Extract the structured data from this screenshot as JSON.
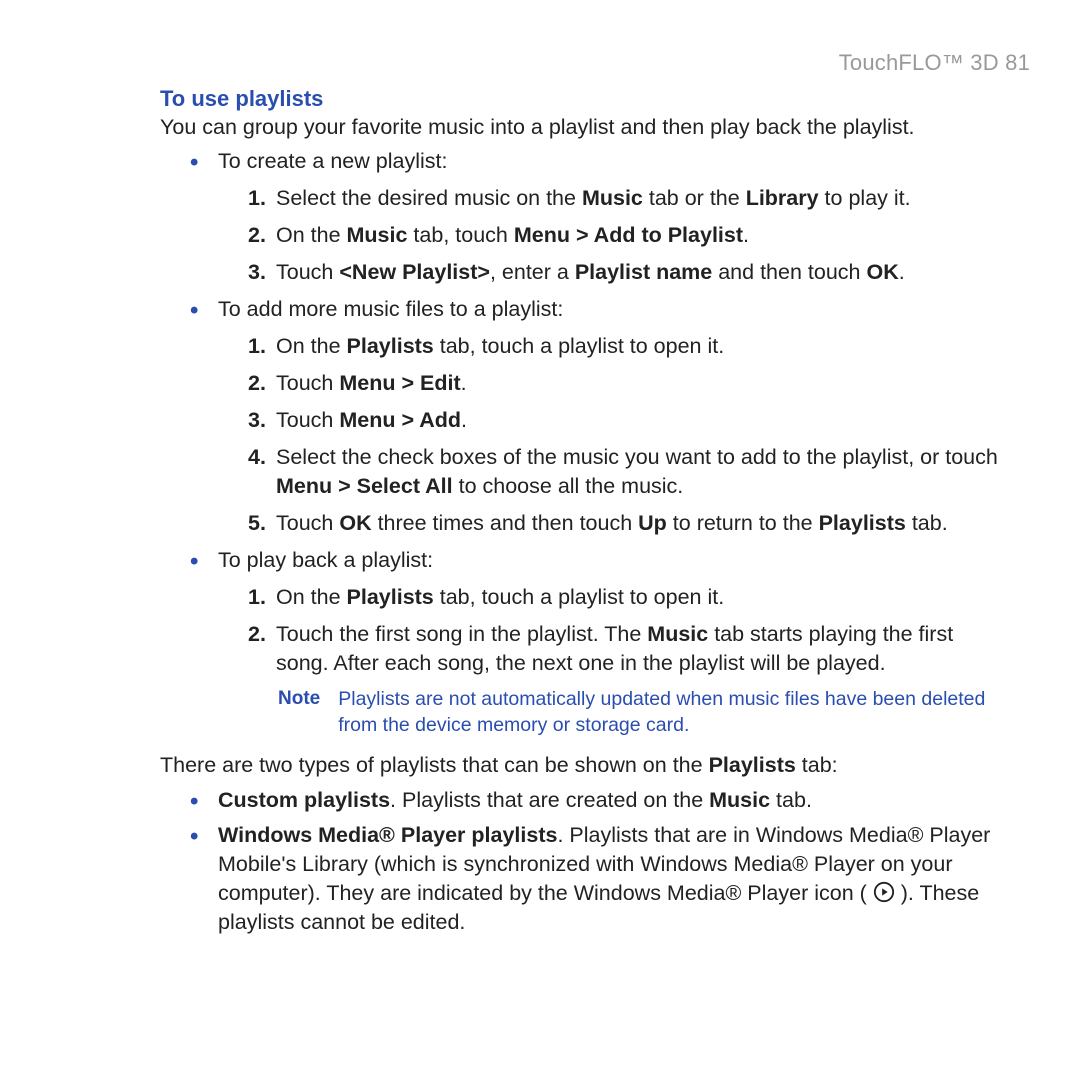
{
  "header": {
    "title": "TouchFLO™ 3D  81"
  },
  "section": {
    "title": "To use playlists",
    "intro": "You can group your favorite music into a playlist and then play back the playlist."
  },
  "groups": [
    {
      "lead": "To create a new playlist:",
      "steps": [
        {
          "parts": [
            {
              "t": "Select the desired music on the "
            },
            {
              "t": "Music",
              "b": true
            },
            {
              "t": " tab or the "
            },
            {
              "t": "Library",
              "b": true
            },
            {
              "t": " to play it."
            }
          ]
        },
        {
          "parts": [
            {
              "t": "On the "
            },
            {
              "t": "Music",
              "b": true
            },
            {
              "t": " tab, touch "
            },
            {
              "t": "Menu > Add to Playlist",
              "b": true
            },
            {
              "t": "."
            }
          ]
        },
        {
          "parts": [
            {
              "t": "Touch "
            },
            {
              "t": "<New Playlist>",
              "b": true
            },
            {
              "t": ", enter a "
            },
            {
              "t": "Playlist name",
              "b": true
            },
            {
              "t": " and then touch "
            },
            {
              "t": "OK",
              "b": true
            },
            {
              "t": "."
            }
          ]
        }
      ]
    },
    {
      "lead": "To add more music files to a playlist:",
      "steps": [
        {
          "parts": [
            {
              "t": "On the "
            },
            {
              "t": "Playlists",
              "b": true
            },
            {
              "t": " tab, touch a playlist to open it."
            }
          ]
        },
        {
          "parts": [
            {
              "t": "Touch "
            },
            {
              "t": "Menu > Edit",
              "b": true
            },
            {
              "t": "."
            }
          ]
        },
        {
          "parts": [
            {
              "t": "Touch "
            },
            {
              "t": "Menu > Add",
              "b": true
            },
            {
              "t": "."
            }
          ]
        },
        {
          "parts": [
            {
              "t": "Select the check boxes of the music you want to add to the playlist, or touch "
            },
            {
              "t": "Menu > Select All",
              "b": true
            },
            {
              "t": " to choose all the music."
            }
          ]
        },
        {
          "parts": [
            {
              "t": "Touch "
            },
            {
              "t": "OK",
              "b": true
            },
            {
              "t": " three times and then touch "
            },
            {
              "t": "Up",
              "b": true
            },
            {
              "t": " to return to the "
            },
            {
              "t": "Playlists",
              "b": true
            },
            {
              "t": " tab."
            }
          ]
        }
      ]
    },
    {
      "lead": "To play back a playlist:",
      "steps": [
        {
          "parts": [
            {
              "t": "On the "
            },
            {
              "t": "Playlists",
              "b": true
            },
            {
              "t": " tab, touch a playlist to open it."
            }
          ]
        },
        {
          "parts": [
            {
              "t": "Touch the first song in the playlist. The "
            },
            {
              "t": "Music",
              "b": true
            },
            {
              "t": " tab starts playing the first song. After each song, the next one in the playlist will be played."
            }
          ]
        }
      ],
      "note": {
        "label": "Note",
        "text": "Playlists are not automatically updated when music files have been deleted from the device memory or storage card."
      }
    }
  ],
  "types_intro": {
    "parts": [
      {
        "t": "There are two types of playlists that can be shown on the "
      },
      {
        "t": "Playlists",
        "b": true
      },
      {
        "t": " tab:"
      }
    ]
  },
  "types": [
    {
      "parts": [
        {
          "t": "Custom playlists",
          "b": true
        },
        {
          "t": ". Playlists that are created on the "
        },
        {
          "t": "Music",
          "b": true
        },
        {
          "t": " tab."
        }
      ]
    },
    {
      "parts": [
        {
          "t": "Windows Media® Player playlists",
          "b": true
        },
        {
          "t": ". Playlists that are in Windows Media® Player Mobile's Library (which is synchronized with Windows Media® Player on your computer). They are indicated by the Windows Media® Player icon ( "
        },
        {
          "icon": "wmp-play-icon"
        },
        {
          "t": " ). These playlists cannot be edited."
        }
      ]
    }
  ]
}
